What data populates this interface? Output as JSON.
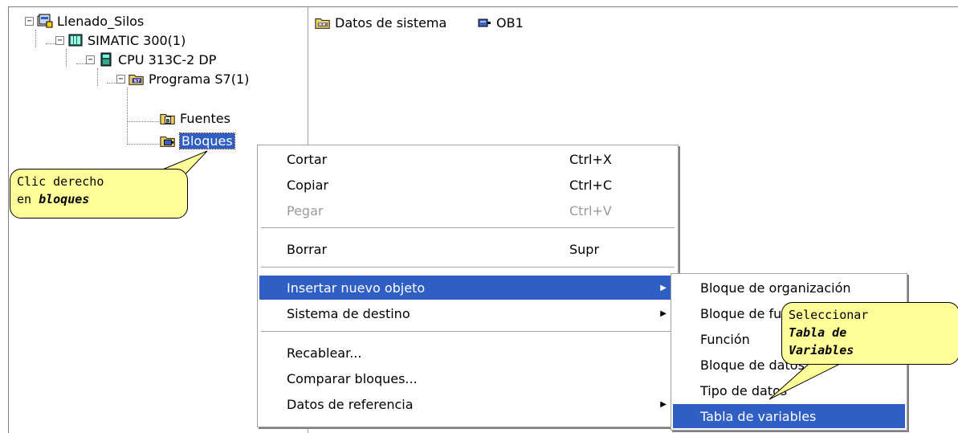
{
  "tree": {
    "nodes": [
      {
        "label": "Llenado_Silos",
        "expander": "−",
        "icon": "project-icon"
      },
      {
        "label": "SIMATIC 300(1)",
        "expander": "−",
        "icon": "simatic-station-icon"
      },
      {
        "label": "CPU 313C-2 DP",
        "expander": "−",
        "icon": "cpu-icon"
      },
      {
        "label": "Programa S7(1)",
        "expander": "−",
        "icon": "s7-program-icon"
      },
      {
        "label": "Fuentes",
        "icon": "folder-sources-icon"
      },
      {
        "label": "Bloques",
        "icon": "folder-blocks-icon",
        "selected": true
      }
    ]
  },
  "list": {
    "items": [
      {
        "label": "Datos de sistema",
        "icon": "system-data-icon"
      },
      {
        "label": "OB1",
        "icon": "block-icon"
      }
    ]
  },
  "context_menu": {
    "items": [
      {
        "label": "Cortar",
        "shortcut": "Ctrl+X"
      },
      {
        "label": "Copiar",
        "shortcut": "Ctrl+C"
      },
      {
        "label": "Pegar",
        "shortcut": "Ctrl+V",
        "disabled": true
      },
      {
        "label": "Borrar",
        "shortcut": "Supr"
      },
      {
        "label": "Insertar nuevo objeto",
        "submenu": true,
        "highlighted": true
      },
      {
        "label": "Sistema de destino",
        "submenu": true
      },
      {
        "label": "Recablear..."
      },
      {
        "label": "Comparar bloques..."
      },
      {
        "label": "Datos de referencia",
        "submenu": true
      }
    ]
  },
  "submenu": {
    "items": [
      {
        "label": "Bloque de organización"
      },
      {
        "label": "Bloque de función"
      },
      {
        "label": "Función"
      },
      {
        "label": "Bloque de datos"
      },
      {
        "label": "Tipo de datos"
      },
      {
        "label": "Tabla de variables",
        "highlighted": true
      }
    ]
  },
  "callouts": {
    "right_click": {
      "line1": "Clic derecho",
      "line2_prefix": "en ",
      "line2_emph": "bloques"
    },
    "select": {
      "line1": "Seleccionar",
      "line2": "Tabla de",
      "line3": "Variables"
    }
  },
  "colors": {
    "highlight": "#2f5fc4",
    "callout_fill": "#ffff99"
  }
}
